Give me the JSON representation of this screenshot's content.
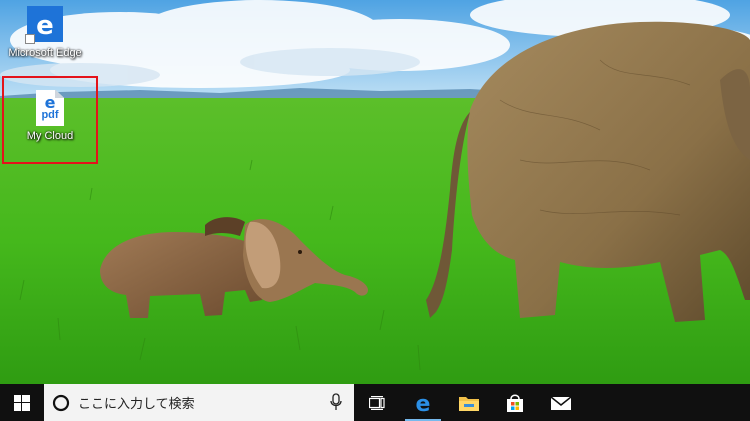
{
  "desktop": {
    "icons": [
      {
        "label": "Microsoft Edge",
        "icon": "edge-icon"
      },
      {
        "label": "My Cloud",
        "icon": "pdf-file-icon",
        "glyph": "pdf",
        "selected": true,
        "highlight_color": "#e4131b"
      }
    ]
  },
  "taskbar": {
    "search_placeholder": "ここに入力して検索",
    "buttons": [
      {
        "name": "task-view",
        "icon": "task-view-icon"
      },
      {
        "name": "edge",
        "icon": "edge-icon",
        "active": true
      },
      {
        "name": "file-explorer",
        "icon": "folder-icon"
      },
      {
        "name": "store",
        "icon": "store-icon"
      },
      {
        "name": "mail",
        "icon": "mail-icon"
      }
    ],
    "colors": {
      "background": "#101010",
      "search_bg": "#f3f3f3",
      "accent": "#76b9ed"
    }
  }
}
